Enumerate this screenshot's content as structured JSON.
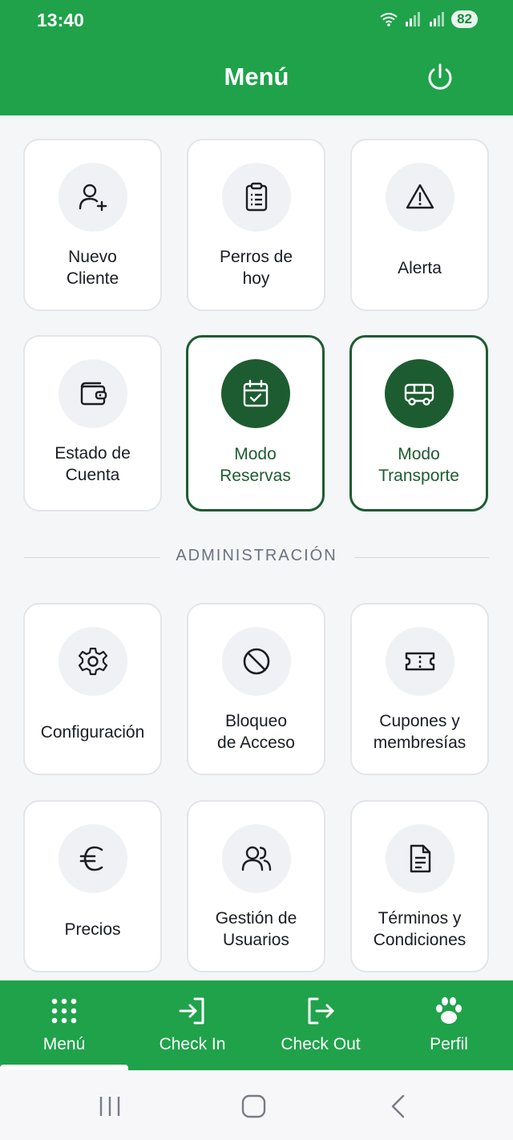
{
  "status_bar": {
    "time": "13:40",
    "battery": "82"
  },
  "header": {
    "title": "Menú"
  },
  "cards": [
    {
      "label": "Nuevo\nCliente",
      "icon": "user-plus-icon"
    },
    {
      "label": "Perros de\nhoy",
      "icon": "clipboard-list-icon"
    },
    {
      "label": "Alerta",
      "icon": "alert-triangle-icon"
    },
    {
      "label": "Estado de\nCuenta",
      "icon": "wallet-icon"
    },
    {
      "label": "Modo\nReservas",
      "icon": "calendar-check-icon",
      "active": true
    },
    {
      "label": "Modo\nTransporte",
      "icon": "bus-icon",
      "active": true
    }
  ],
  "admin_section": {
    "title": "ADMINISTRACIÓN"
  },
  "admin_cards": [
    {
      "label": "Configuración",
      "icon": "gear-icon"
    },
    {
      "label": "Bloqueo\nde Acceso",
      "icon": "ban-icon"
    },
    {
      "label": "Cupones y\nmembresías",
      "icon": "ticket-icon"
    },
    {
      "label": "Precios",
      "icon": "euro-icon"
    },
    {
      "label": "Gestión de\nUsuarios",
      "icon": "users-icon"
    },
    {
      "label": "Términos y\nCondiciones",
      "icon": "document-icon"
    }
  ],
  "bottom_nav": [
    {
      "label": "Menú",
      "icon": "grid-dots-icon",
      "selected": true
    },
    {
      "label": "Check In",
      "icon": "login-icon"
    },
    {
      "label": "Check Out",
      "icon": "logout-icon"
    },
    {
      "label": "Perfil",
      "icon": "paw-icon"
    }
  ],
  "colors": {
    "primary": "#1fa24a",
    "active_dark": "#1d5c31",
    "background": "#f5f6f8"
  }
}
